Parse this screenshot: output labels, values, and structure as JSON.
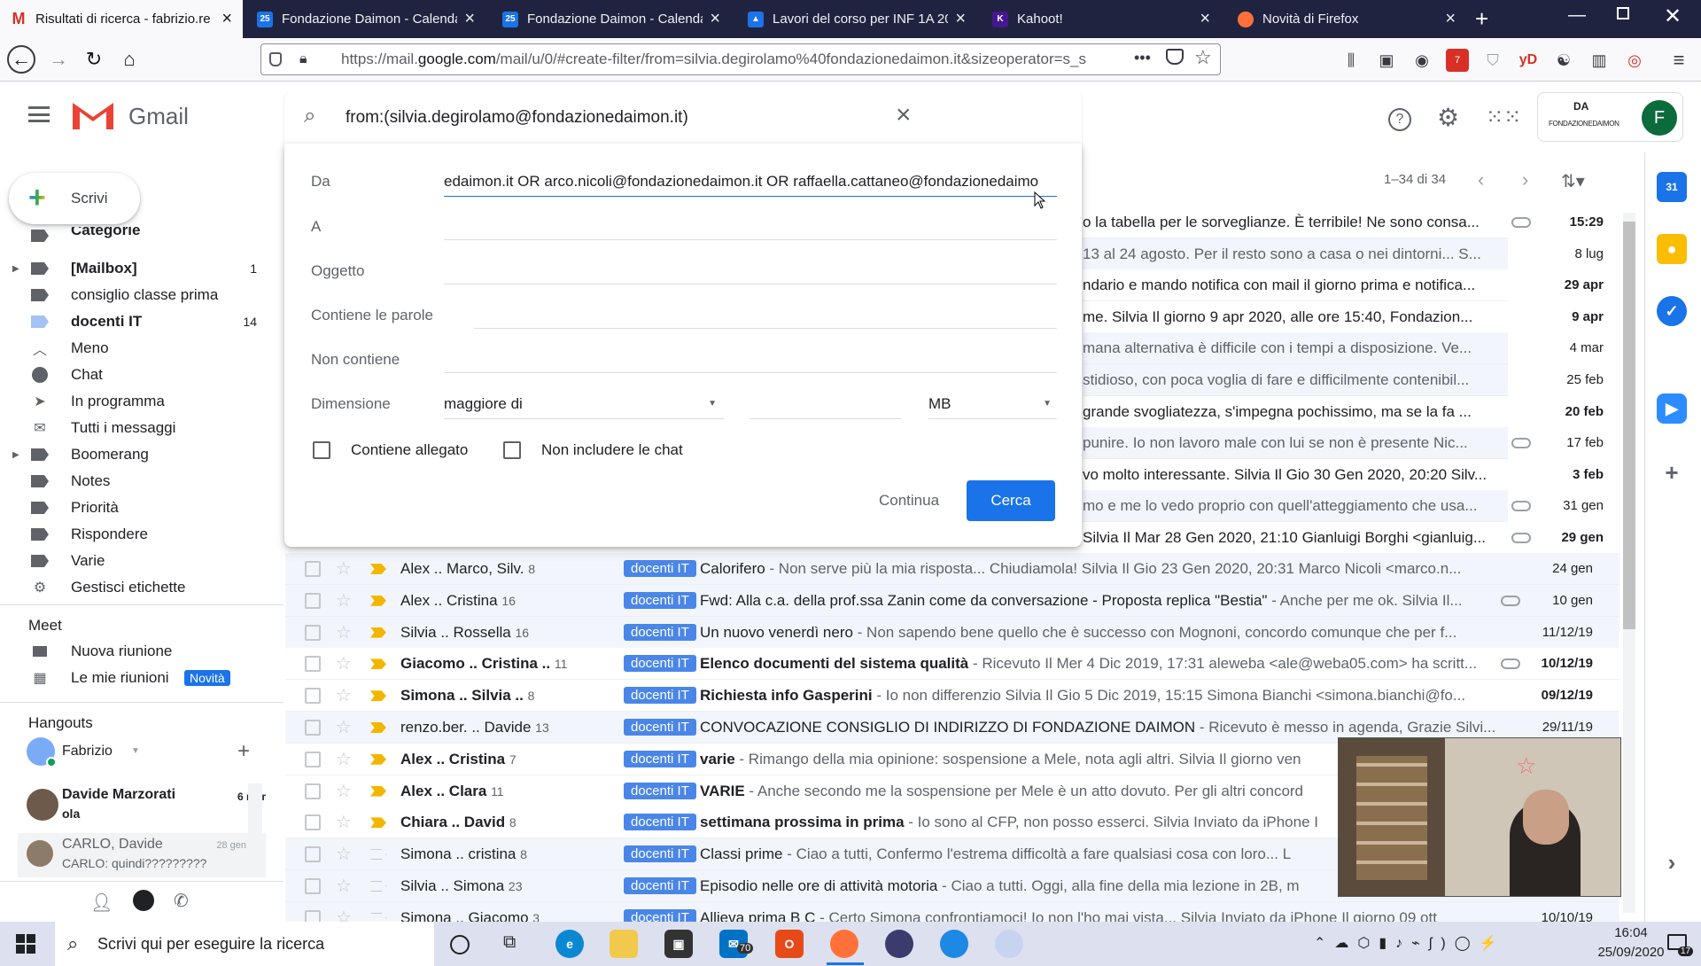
{
  "browser": {
    "tabs": [
      {
        "title": "Risultati di ricerca - fabrizio.re",
        "icon": "gmail-icon",
        "color": "#d93025",
        "active": true
      },
      {
        "title": "Fondazione Daimon - Calenda",
        "icon": "calendar-icon",
        "color": "#1a73e8",
        "badge": "25"
      },
      {
        "title": "Fondazione Daimon - Calenda",
        "icon": "calendar-icon",
        "color": "#1a73e8",
        "badge": "25"
      },
      {
        "title": "Lavori del corso per INF 1A 20",
        "icon": "classroom-icon",
        "color": "#1a73e8"
      },
      {
        "title": "Kahoot!",
        "icon": "kahoot-icon",
        "color": "#46178f",
        "badge": "K"
      },
      {
        "title": "Novità di Firefox",
        "icon": "firefox-icon",
        "color": "#ff7139"
      }
    ],
    "url_prefix": "https://mail.",
    "url_domain": "google.com",
    "url_rest": "/mail/u/0/#create-filter/from=silvia.degirolamo%40fondazionedaimon.it&sizeoperator=s_s",
    "ext_badge": "7"
  },
  "gmail": {
    "logo_text": "Gmail",
    "search_query": "from:(silvia.degirolamo@fondazionedaimon.it)",
    "org_logo_text": "FONDAZIONEDAIMON",
    "org_logo_mark": "DA",
    "avatar_letter": "F",
    "pagination": "1–34 di 34",
    "compose_label": "Scrivi"
  },
  "filter": {
    "from_label": "Da",
    "from_value": "edaimon.it OR arco.nicoli@fondazionedaimon.it OR raffaella.cattaneo@fondazionedaimo",
    "to_label": "A",
    "subject_label": "Oggetto",
    "has_words_label": "Contiene le parole",
    "not_has_label": "Non contiene",
    "size_label": "Dimensione",
    "size_operator": "maggiore di",
    "size_unit": "MB",
    "attachment_label": "Contiene allegato",
    "no_chats_label": "Non includere le chat",
    "continue_label": "Continua",
    "search_label": "Cerca"
  },
  "sidebar": {
    "items": [
      {
        "label": "Categorie",
        "count": ""
      },
      {
        "label": "[Mailbox]",
        "count": "1",
        "bold": true
      },
      {
        "label": "consiglio classe prima",
        "count": ""
      },
      {
        "label": "docenti IT",
        "count": "14",
        "bold": true
      },
      {
        "label": "Meno",
        "count": ""
      },
      {
        "label": "Chat",
        "count": ""
      },
      {
        "label": "In programma",
        "count": ""
      },
      {
        "label": "Tutti i messaggi",
        "count": ""
      },
      {
        "label": "Boomerang",
        "count": ""
      },
      {
        "label": "Notes",
        "count": ""
      },
      {
        "label": "Priorità",
        "count": ""
      },
      {
        "label": "Rispondere",
        "count": ""
      },
      {
        "label": "Varie",
        "count": ""
      },
      {
        "label": "Gestisci etichette",
        "count": ""
      }
    ],
    "meet_title": "Meet",
    "meet_new": "Nuova riunione",
    "meet_mine": "Le mie riunioni",
    "meet_badge": "Novità",
    "hangouts_title": "Hangouts",
    "hangouts_user": "Fabrizio",
    "chats": [
      {
        "name": "Davide Marzorati",
        "msg": "ola",
        "date": "6 mar"
      },
      {
        "name": "CARLO, Davide",
        "msg": "CARLO: quindi?????????",
        "date": "28 gen"
      }
    ]
  },
  "partial_rows": [
    {
      "text": "o la tabella per le sorveglianze. È terribile! Ne sono consa...",
      "date": "15:29",
      "unread": true,
      "clip": true
    },
    {
      "text": "13 al 24 agosto. Per il resto sono a casa o nei dintorni... S...",
      "date": "8 lug",
      "unread": false,
      "clip": false
    },
    {
      "text": "ndario e mando notifica con mail il giorno prima e notifica...",
      "date": "29 apr",
      "unread": true,
      "clip": false
    },
    {
      "text": "me. Silvia Il giorno 9 apr 2020, alle ore 15:40, Fondazion...",
      "date": "9 apr",
      "unread": true,
      "clip": false
    },
    {
      "text": "mana alternativa è difficile con i tempi a disposizione. Ve...",
      "date": "4 mar",
      "unread": false,
      "clip": false
    },
    {
      "text": "stidioso, con poca voglia di fare e difficilmente contenibil...",
      "date": "25 feb",
      "unread": false,
      "clip": false
    },
    {
      "text": "grande svogliatezza, s'impegna pochissimo, ma se la fa ...",
      "date": "20 feb",
      "unread": true,
      "clip": false
    },
    {
      "text": "punire. Io non lavoro male con lui se non è presente Nic...",
      "date": "17 feb",
      "unread": false,
      "clip": true
    },
    {
      "text": "vo molto interessante. Silvia Il Gio 30 Gen 2020, 20:20 Silv...",
      "date": "3 feb",
      "unread": true,
      "clip": false
    },
    {
      "text": "mo e me lo vedo proprio con quell'atteggiamento che usa...",
      "date": "31 gen",
      "unread": false,
      "clip": true
    },
    {
      "text": "Silvia Il Mar 28 Gen 2020, 21:10 Gianluigi Borghi <gianluig...",
      "date": "29 gen",
      "unread": true,
      "clip": true
    }
  ],
  "rows": [
    {
      "sender": "Alex .. Marco, Silv.",
      "n": "8",
      "label": "docenti IT",
      "subject": "Calorifero",
      "snippet": " - Non serve più la mia risposta... Chiudiamola! Silvia Il Gio 23 Gen 2020, 20:31 Marco Nicoli <marco.n...",
      "date": "24 gen",
      "unread": false,
      "imp": true
    },
    {
      "sender": "Alex .. Cristina",
      "n": "16",
      "label": "docenti IT",
      "subject": "Fwd: Alla c.a. della prof.ssa Zanin come da conversazione - Proposta replica \"Bestia\"",
      "snippet": " - Anche per me ok. Silvia Il...",
      "date": "10 gen",
      "unread": false,
      "imp": true
    },
    {
      "sender": "Silvia .. Rossella",
      "n": "16",
      "label": "docenti IT",
      "subject": "Un nuovo venerdì nero",
      "snippet": " - Non sapendo bene quello che è successo con Mognoni, concordo comunque che per f...",
      "date": "11/12/19",
      "unread": false,
      "imp": true
    },
    {
      "sender": "Giacomo .. Cristina ..",
      "n": "11",
      "label": "docenti IT",
      "subject": "Elenco documenti del sistema qualità",
      "snippet": " - Ricevuto Il Mer 4 Dic 2019, 17:31 aleweba <ale@weba05.com> ha scritt...",
      "date": "10/12/19",
      "unread": true,
      "imp": true
    },
    {
      "sender": "Simona .. Silvia ..",
      "n": "8",
      "label": "docenti IT",
      "subject": "Richiesta info Gasperini",
      "snippet": " - Io non differenzio Silvia Il Gio 5 Dic 2019, 15:15 Simona Bianchi <simona.bianchi@fo...",
      "date": "09/12/19",
      "unread": true,
      "imp": true
    },
    {
      "sender": "renzo.ber. .. Davide",
      "n": "13",
      "label": "docenti IT",
      "subject": "CONVOCAZIONE CONSIGLIO DI INDIRIZZO DI FONDAZIONE DAIMON",
      "snippet": " - Ricevuto è messo in agenda, Grazie Silvi...",
      "date": "29/11/19",
      "unread": false,
      "imp": true
    },
    {
      "sender": "Alex .. Cristina",
      "n": "7",
      "label": "docenti IT",
      "subject": "varie",
      "snippet": " - Rimango della mia opinione: sospensione a Mele, nota agli altri. Silvia Il giorno ven",
      "date": "",
      "unread": true,
      "imp": true
    },
    {
      "sender": "Alex .. Clara",
      "n": "11",
      "label": "docenti IT",
      "subject": "VARIE",
      "snippet": " - Anche secondo me la sospensione per Mele è un atto dovuto. Per gli altri concord",
      "date": "",
      "unread": true,
      "imp": true
    },
    {
      "sender": "Chiara .. David",
      "n": "8",
      "label": "docenti IT",
      "subject": "settimana prossima in prima",
      "snippet": " - Io sono al CFP, non posso esserci. Silvia Inviato da iPhone I",
      "date": "",
      "unread": true,
      "imp": true
    },
    {
      "sender": "Simona .. cristina",
      "n": "8",
      "label": "docenti IT",
      "subject": "Classi prime",
      "snippet": " - Ciao a tutti, Confermo l'estrema difficoltà a fare qualsiasi cosa con loro... L",
      "date": "",
      "unread": false,
      "imp": false
    },
    {
      "sender": "Silvia .. Simona",
      "n": "23",
      "label": "docenti IT",
      "subject": "Episodio nelle ore di attività motoria",
      "snippet": " - Ciao a tutti. Oggi, alla fine della mia lezione in 2B, m",
      "date": "",
      "unread": false,
      "imp": false
    },
    {
      "sender": "Simona .. Giacomo",
      "n": "3",
      "label": "docenti IT",
      "subject": "Allieva prima B C",
      "snippet": " - Certo Simona confrontiamoci! Io non l'ho mai vista... Silvia Inviato da iPhone Il giorno 09 ott",
      "date": "10/10/19",
      "unread": false,
      "imp": false
    }
  ],
  "taskbar": {
    "search_placeholder": "Scrivi qui per eseguire la ricerca",
    "time": "16:04",
    "date": "25/09/2020",
    "mail_badge": "70",
    "notif_badge": "17"
  }
}
